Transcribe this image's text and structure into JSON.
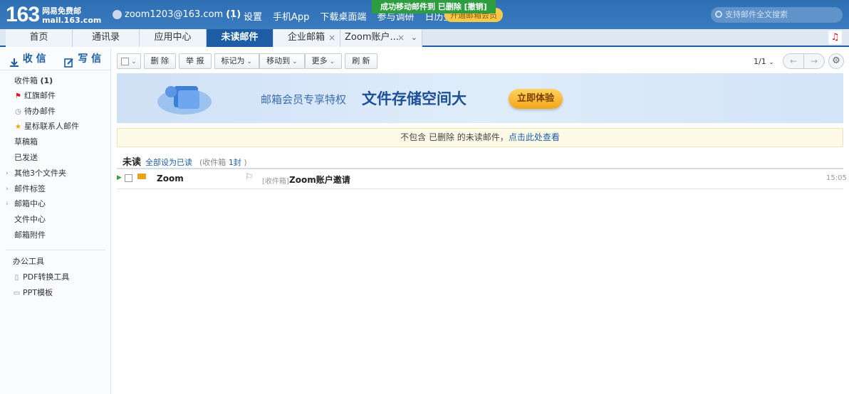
{
  "header": {
    "logo_number": "163",
    "logo_cn": "网易免费邮",
    "logo_domain": "mail.163.com",
    "account": "zoom1203@163.com",
    "account_count": "(1)",
    "links": [
      "设置",
      "手机App",
      "下载桌面端",
      "参与调研",
      "日历查阅"
    ],
    "vip": "开通邮箱会员",
    "toast": "成功移动邮件到 已删除 [撤销]",
    "search_placeholder": "支持邮件全文搜索"
  },
  "tabs": [
    "首页",
    "通讯录",
    "应用中心",
    "未读邮件",
    "企业邮箱",
    "Zoom账户..."
  ],
  "sidebar": {
    "receive": "收 信",
    "write": "写 信",
    "items": [
      "收件箱",
      "红旗邮件",
      "待办邮件",
      "星标联系人邮件",
      "草稿箱",
      "已发送",
      "其他3个文件夹",
      "邮件标签",
      "邮箱中心",
      "文件中心",
      "邮箱附件"
    ],
    "inbox_count": "(1)",
    "tools_title": "办公工具",
    "tools": [
      "PDF转换工具",
      "PPT模板"
    ]
  },
  "toolbar": {
    "delete": "删 除",
    "report": "举 报",
    "mark": "标记为",
    "move": "移动到",
    "more": "更多",
    "refresh": "刷 新",
    "pager": "1/1"
  },
  "banner": {
    "t1": "邮箱会员专享特权",
    "t2": "文件存储空间大",
    "btn": "立即体验"
  },
  "notice": {
    "text": "不包含 已删除 的未读邮件，",
    "link": "点击此处查看"
  },
  "section": {
    "title": "未读",
    "mark_all": "全部设为已读",
    "count_prefix": "(收件箱",
    "count": "1封",
    "count_suffix": ")"
  },
  "mail": {
    "sender": "Zoom",
    "folder": "[收件箱]",
    "subject": "Zoom账户邀请",
    "time": "15:05"
  },
  "colors": {
    "brand": "#1d5da4",
    "topbar": "#3a7bbf"
  }
}
